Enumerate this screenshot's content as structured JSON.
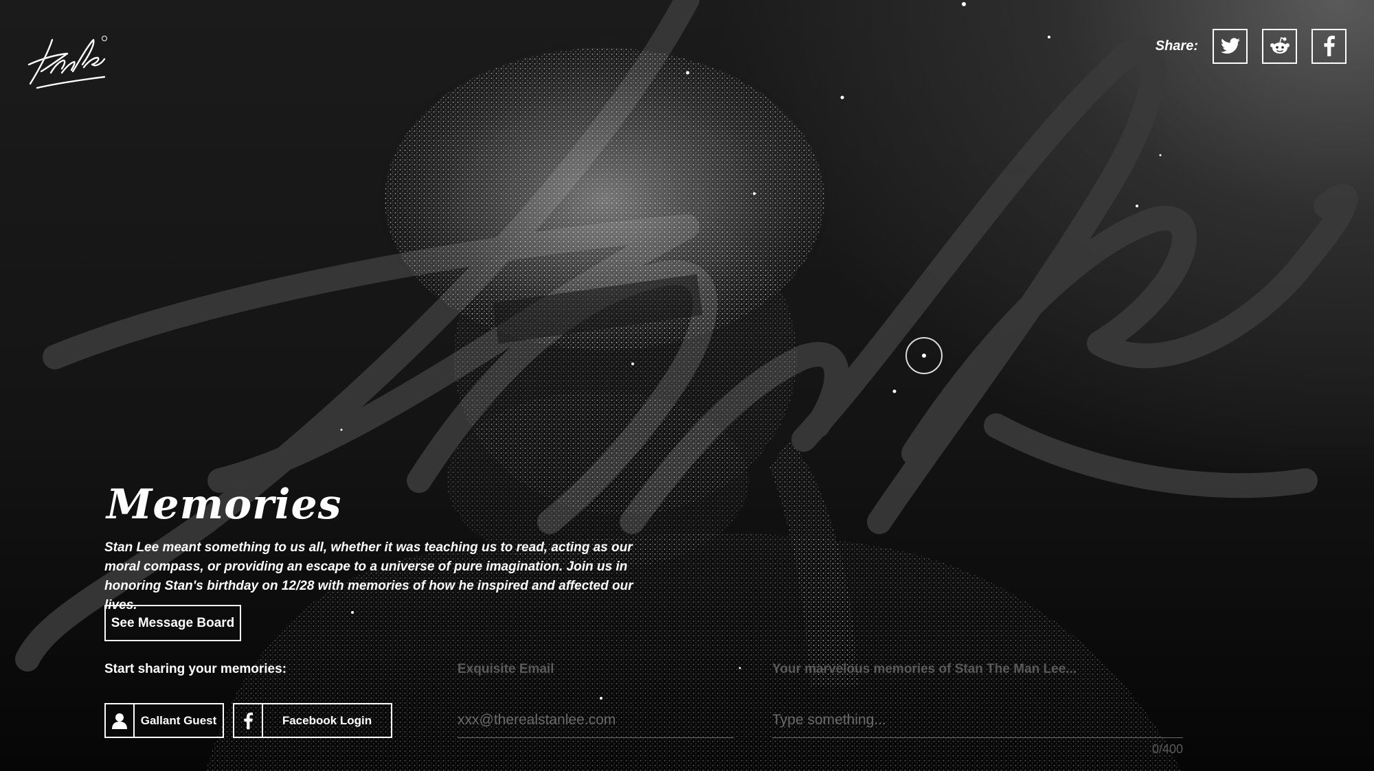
{
  "header": {
    "logo_text": "Stan Lee",
    "share_label": "Share:",
    "share_buttons": [
      {
        "name": "twitter",
        "icon": "twitter-icon"
      },
      {
        "name": "reddit",
        "icon": "reddit-icon"
      },
      {
        "name": "facebook",
        "icon": "facebook-icon"
      }
    ]
  },
  "hero": {
    "title": "Memories",
    "intro": "Stan Lee meant something to us all, whether it was teaching us to read, acting as our moral compass, or providing an escape to a universe of pure imagination. Join us in honoring Stan's birthday on 12/28 with memories of how he inspired and affected our lives.",
    "message_board_button": "See Message Board"
  },
  "share_form": {
    "start_label": "Start sharing your memories:",
    "guest_button": "Gallant Guest",
    "facebook_button": "Facebook Login",
    "email_label": "Exquisite Email",
    "email_placeholder": "xxx@therealstanlee.com",
    "memory_label": "Your marvelous memories of Stan The Man Lee...",
    "memory_placeholder": "Type something...",
    "counter": "0/400"
  },
  "colors": {
    "text": "#ffffff",
    "muted": "#5a5a5a",
    "background": "#141414"
  }
}
